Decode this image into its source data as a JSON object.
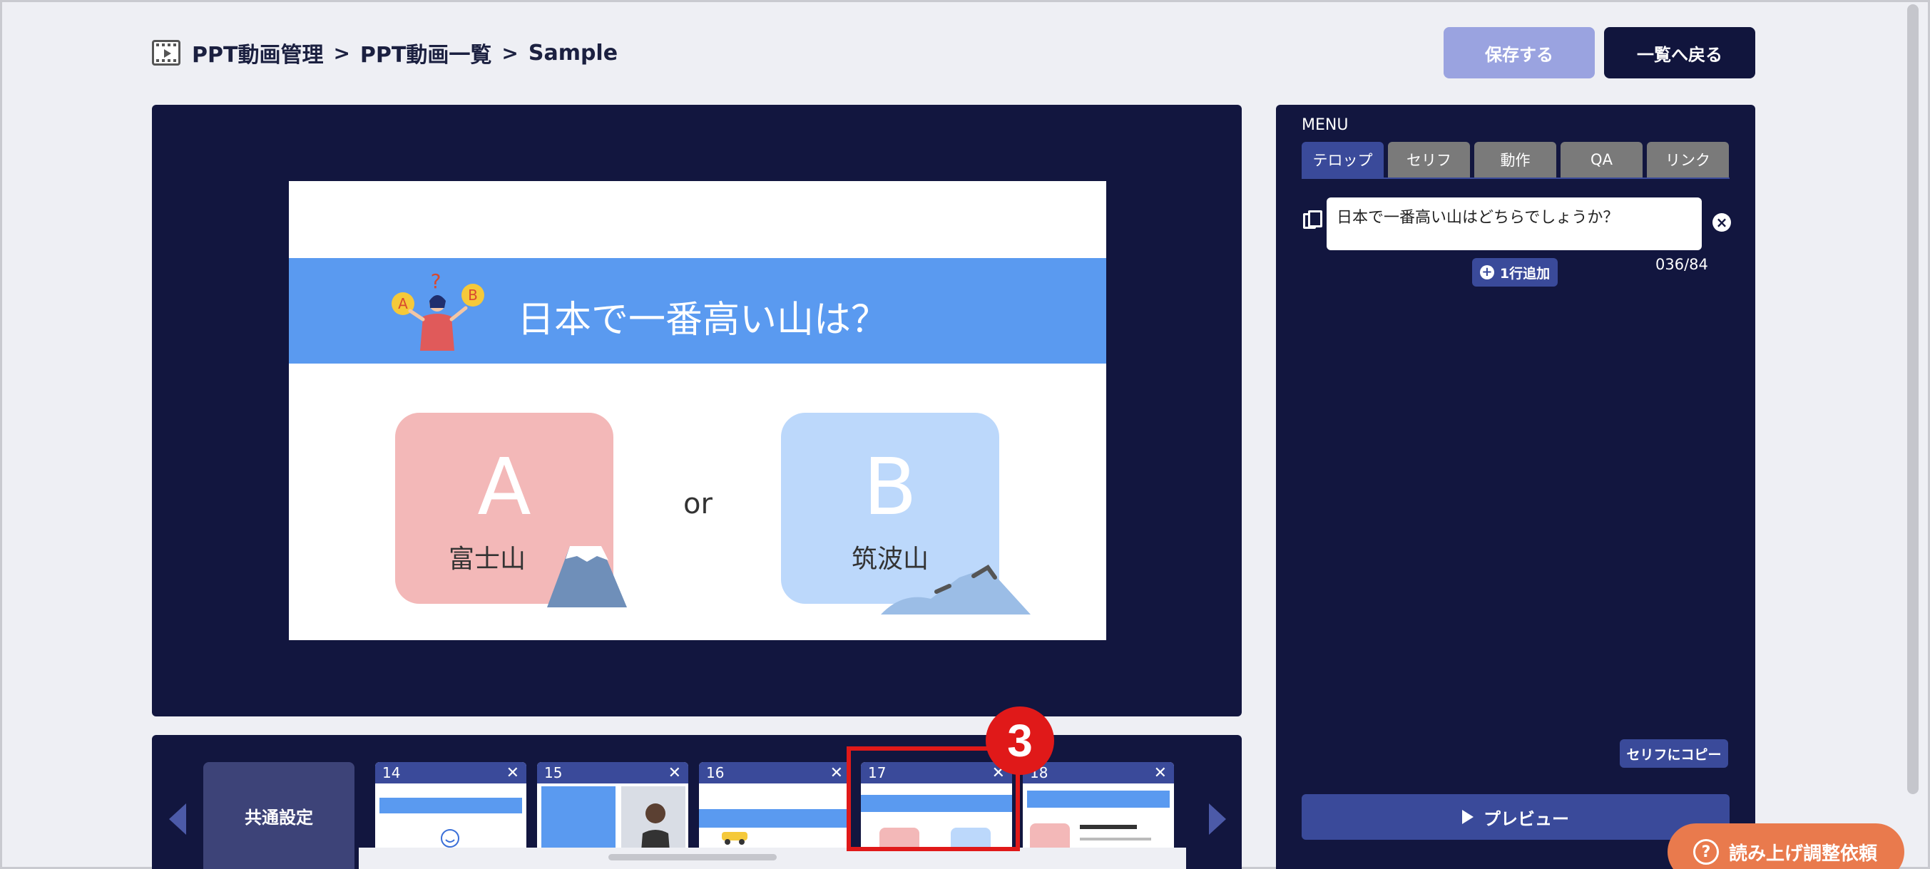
{
  "breadcrumb": {
    "items": [
      "PPT動画管理",
      "PPT動画一覧",
      "Sample"
    ],
    "separator": ">"
  },
  "header": {
    "save_label": "保存する",
    "back_label": "一覧へ戻る"
  },
  "slide": {
    "title": "日本で一番高い山は？",
    "option_a_letter": "A",
    "option_a_label": "富士山",
    "or_text": "or",
    "option_b_letter": "B",
    "option_b_label": "筑波山"
  },
  "filmstrip": {
    "common_settings_label": "共通設定",
    "thumbnails": [
      {
        "number": "14",
        "close": "✕"
      },
      {
        "number": "15",
        "close": "✕"
      },
      {
        "number": "16",
        "close": "✕"
      },
      {
        "number": "17",
        "close": "✕"
      },
      {
        "number": "18",
        "close": "✕"
      }
    ],
    "selected_index": 3,
    "step_badge": "3"
  },
  "menu": {
    "title": "MENU",
    "tabs": [
      "テロップ",
      "セリフ",
      "動作",
      "QA",
      "リンク"
    ],
    "active_tab": "テロップ",
    "caption_text": "日本で一番高い山はどちらでしょうか？",
    "add_line_label": "1行追加",
    "char_counter": "036/84",
    "copy_to_serif_label": "セリフにコピー",
    "preview_label": "プレビュー"
  },
  "fab": {
    "label": "読み上げ調整依頼",
    "icon": "?"
  },
  "colors": {
    "navy": "#12163f",
    "accent_blue": "#3a4a9a",
    "slide_band": "#5a9af0",
    "save_disabled": "#9aa3e0",
    "highlight_red": "#e01919",
    "fab_orange": "#e97a4d"
  }
}
